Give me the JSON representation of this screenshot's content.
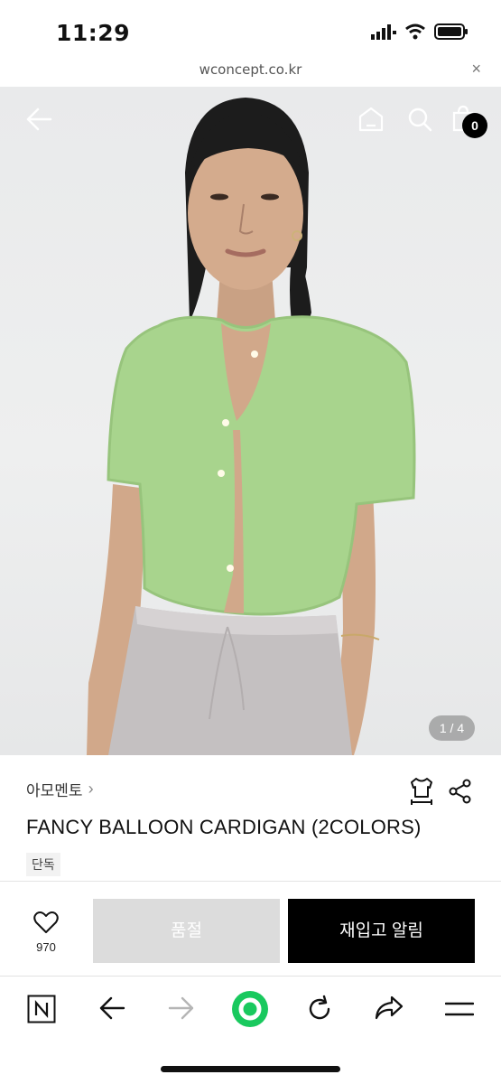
{
  "status_bar": {
    "time": "11:29"
  },
  "browser": {
    "url": "wconcept.co.kr",
    "close_label": "×"
  },
  "header": {
    "cart_count": "0"
  },
  "gallery": {
    "page_indicator": "1 / 4"
  },
  "product": {
    "brand": "아모멘토",
    "brand_chevron": "›",
    "title": "FANCY BALLOON CARDIGAN (2COLORS)",
    "tag": "단독"
  },
  "actions": {
    "like_count": "970",
    "soldout_label": "품절",
    "restock_label": "재입고 알림"
  },
  "icons": {
    "back": "arrow-left-icon",
    "home": "home-icon",
    "search": "search-icon",
    "cart": "shopping-bag-icon",
    "size": "size-guide-icon",
    "share": "share-icon",
    "like": "heart-icon",
    "naver": "naver-n-icon",
    "green_dot": "green-circle-icon",
    "reload": "reload-icon",
    "menu": "hamburger-icon"
  },
  "colors": {
    "accent_green": "#19c95e",
    "soldout_gray": "#dcdcdc",
    "primary_black": "#000000"
  }
}
